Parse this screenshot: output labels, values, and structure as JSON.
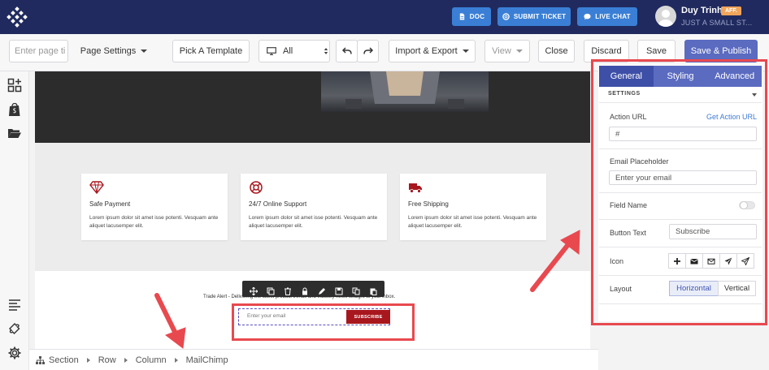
{
  "topbar": {
    "buttons": [
      {
        "label": "DOC",
        "icon": "document-icon"
      },
      {
        "label": "SUBMIT TICKET",
        "icon": "lifebuoy-icon"
      },
      {
        "label": "LIVE CHAT",
        "icon": "chat-icon"
      }
    ],
    "user": {
      "name": "Duy Trinh",
      "badge": "AFF.",
      "subtitle": "JUST A SMALL ST..."
    }
  },
  "toolbar": {
    "page_title_placeholder": "Enter page ti",
    "page_settings": "Page Settings",
    "pick_template": "Pick A Template",
    "device": "All",
    "import_export": "Import & Export",
    "view": "View",
    "close": "Close",
    "discard": "Discard",
    "save": "Save",
    "save_publish": "Save & Publish"
  },
  "canvas": {
    "features": [
      {
        "title": "Safe Payment",
        "text": "Lorem ipsum dolor sit amet isse potenti. Vesquam ante aliquet lacusemper elit.",
        "icon": "diamond-icon"
      },
      {
        "title": "24/7 Online Support",
        "text": "Lorem ipsum dolor sit amet isse potenti. Vesquam ante aliquet lacusemper elit.",
        "icon": "lifebuoy-icon"
      },
      {
        "title": "Free Shipping",
        "text": "Lorem ipsum dolor sit amet isse potenti. Vesquam ante aliquet lacusemper elit.",
        "icon": "truck-icon"
      }
    ],
    "trade_alert": "Trade Alert - Delivering the latest product trends and industry news straight to your inbox.",
    "email_placeholder": "Enter your email",
    "subscribe": "SUBSCRIBE"
  },
  "breadcrumb": [
    "Section",
    "Row",
    "Column",
    "MailChimp"
  ],
  "panel": {
    "tabs": [
      "General",
      "Styling",
      "Advanced"
    ],
    "active_tab": "General",
    "settings_heading": "SETTINGS",
    "action_url_label": "Action URL",
    "get_action_url": "Get Action URL",
    "action_url_value": "#",
    "email_placeholder_label": "Email Placeholder",
    "email_placeholder_value": "Enter your email",
    "field_name_label": "Field Name",
    "button_text_label": "Button Text",
    "button_text_value": "Subscribe",
    "icon_label": "Icon",
    "icons": [
      "plus-icon",
      "envelope-filled-icon",
      "envelope-outline-icon",
      "paper-plane-icon",
      "paper-plane-outline-icon"
    ],
    "layout_label": "Layout",
    "layout_options": [
      "Horizontal",
      "Vertical"
    ],
    "layout_selected": "Horizontal"
  },
  "colors": {
    "topbar": "#202a5e",
    "accent": "#5b6bc0",
    "highlight": "#e8494f",
    "subscribe_button": "#a8171e"
  }
}
